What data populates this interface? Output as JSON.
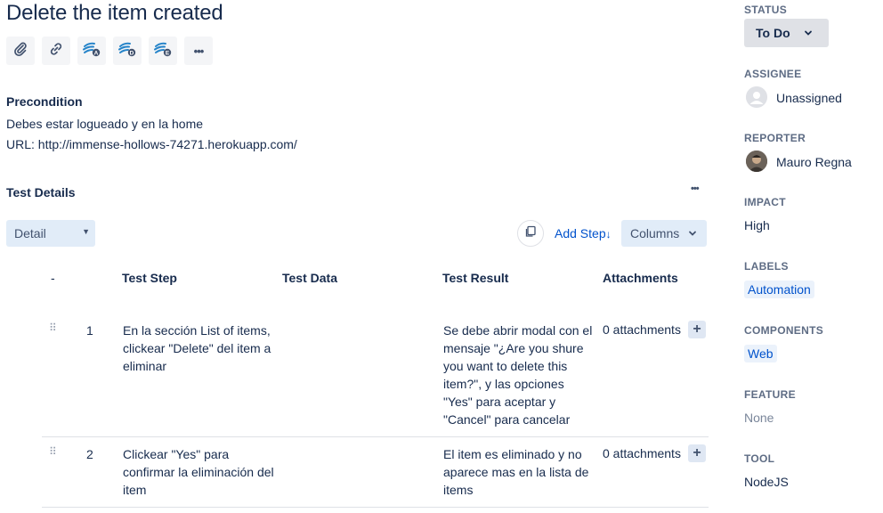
{
  "issue": {
    "title": "Delete the item created"
  },
  "toolbar": {
    "icons": [
      "attachment-icon",
      "link-icon",
      "xray-a-icon",
      "xray-d-icon",
      "xray-e-icon",
      "more-icon"
    ],
    "more_label": "•••"
  },
  "precondition": {
    "heading": "Precondition",
    "line1": "Debes estar logueado y en la home",
    "line2": "URL: http://immense-hollows-74271.herokuapp.com/"
  },
  "test_details": {
    "heading": "Test Details",
    "more_label": "•••",
    "view_select": "Detail",
    "add_step_label": "Add Step",
    "add_step_arrow": "↓",
    "columns_label": "Columns",
    "columns": {
      "num": "-",
      "step": "Test Step",
      "data": "Test Data",
      "result": "Test Result",
      "attachments": "Attachments"
    },
    "rows": [
      {
        "num": "1",
        "step": "En la sección List of items, clickear \"Delete\" del item a eliminar",
        "data": "",
        "result": "Se debe abrir modal con el mensaje \"¿Are you shure you want to delete this item?\", y las opciones \"Yes\" para aceptar y \"Cancel\" para cancelar",
        "attachments": "0 attachments"
      },
      {
        "num": "2",
        "step": "Clickear \"Yes\" para confirmar la eliminación del item",
        "data": "",
        "result": "El item es eliminado y no aparece mas en la lista de items",
        "attachments": "0 attachments"
      }
    ],
    "drag_glyph": "⠿",
    "plus_label": "+"
  },
  "sidebar": {
    "status_label": "STATUS",
    "status_value": "To Do",
    "assignee_label": "ASSIGNEE",
    "assignee_value": "Unassigned",
    "reporter_label": "REPORTER",
    "reporter_value": "Mauro Regna",
    "impact_label": "IMPACT",
    "impact_value": "High",
    "labels_label": "LABELS",
    "labels_value": "Automation",
    "components_label": "COMPONENTS",
    "components_value": "Web",
    "feature_label": "FEATURE",
    "feature_value": "None",
    "tool_label": "TOOL",
    "tool_value": "NodeJS"
  },
  "colors": {
    "text": "#172b4d",
    "link": "#0052cc",
    "muted": "#5e6c84",
    "button_bg": "#f4f5f7",
    "select_bg": "#e1ecf8"
  }
}
